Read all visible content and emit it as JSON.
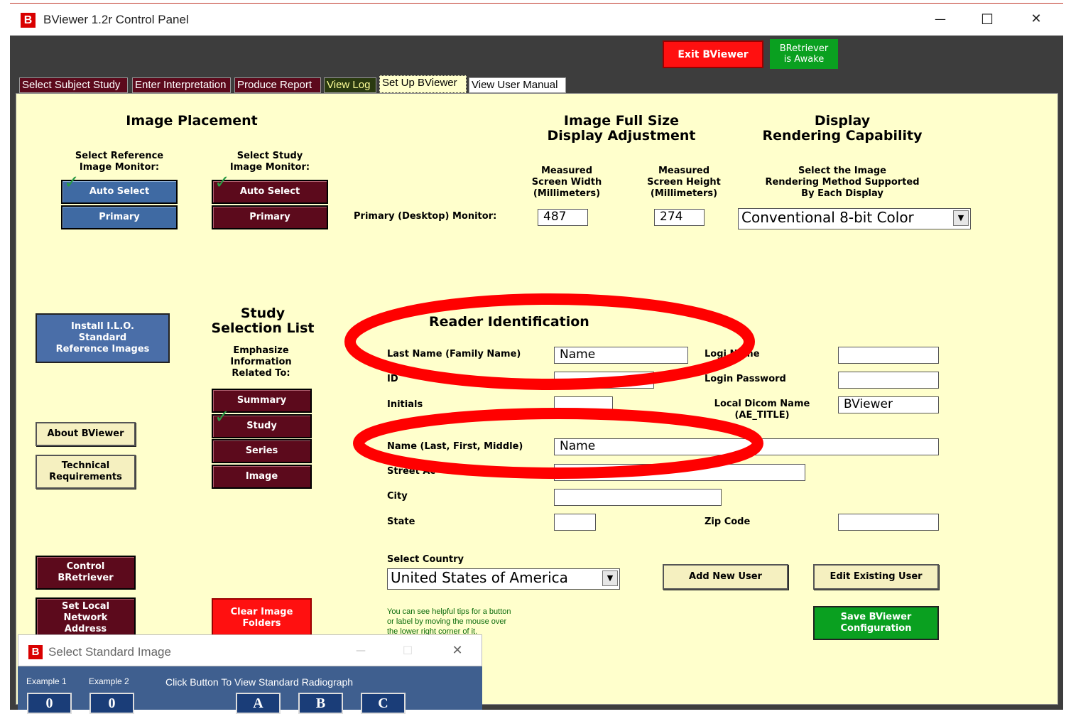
{
  "window": {
    "title": "BViewer 1.2r Control Panel",
    "logo_letter": "B",
    "minimize": "—",
    "maximize": "☐",
    "close": "✕"
  },
  "top_buttons": {
    "exit": "Exit BViewer",
    "bretriever_line1": "BRetriever",
    "bretriever_line2": "is Awake"
  },
  "tabs": [
    "Select Subject Study",
    "Enter Interpretation",
    "Produce Report",
    "View Log",
    "Set Up BViewer",
    "View User Manual"
  ],
  "image_placement": {
    "title": "Image Placement",
    "ref_label_1": "Select Reference",
    "ref_label_2": "Image Monitor:",
    "study_label_1": "Select Study",
    "study_label_2": "Image Monitor:",
    "auto_select": "Auto Select",
    "primary": "Primary"
  },
  "full_size": {
    "title_1": "Image Full Size",
    "title_2": "Display Adjustment",
    "width_label_1": "Measured",
    "width_label_2": "Screen Width",
    "width_label_3": "(Millimeters)",
    "height_label_1": "Measured",
    "height_label_2": "Screen Height",
    "height_label_3": "(Millimeters)",
    "monitor_label": "Primary (Desktop) Monitor:",
    "width_value": "487",
    "height_value": "274"
  },
  "rendering": {
    "title_1": "Display",
    "title_2": "Rendering Capability",
    "label_1": "Select the Image",
    "label_2": "Rendering Method Supported",
    "label_3": "By Each Display",
    "selected": "Conventional 8-bit Color"
  },
  "left_buttons": {
    "install_1": "Install I.L.O.",
    "install_2": "Standard",
    "install_3": "Reference Images",
    "about": "About BViewer",
    "tech_1": "Technical",
    "tech_2": "Requirements",
    "control_1": "Control",
    "control_2": "BRetriever",
    "setlocal_1": "Set Local",
    "setlocal_2": "Network",
    "setlocal_3": "Address"
  },
  "study_list": {
    "title_1": "Study",
    "title_2": "Selection List",
    "label_1": "Emphasize",
    "label_2": "Information",
    "label_3": "Related To:",
    "summary": "Summary",
    "study": "Study",
    "series": "Series",
    "image": "Image",
    "clear_1": "Clear Image",
    "clear_2": "Folders"
  },
  "reader": {
    "title": "Reader Identification",
    "last_name_label": "Last Name (Family Name)",
    "last_name_value": "Name",
    "id_label": "ID",
    "initials_label": "Initials",
    "full_name_label": "Name (Last, First, Middle)",
    "full_name_value": "Name",
    "street_label": "Street Ac",
    "city_label": "City",
    "state_label": "State",
    "zip_label": "Zip Code",
    "login_name_label": "Logi     Name",
    "login_password_label": "Login Password",
    "dicom_label_1": "Local Dicom Name",
    "dicom_label_2": "(AE_TITLE)",
    "dicom_value": "BViewer",
    "country_label": "Select Country",
    "country_value": "United States of America",
    "add_user": "Add New User",
    "edit_user": "Edit Existing User",
    "save_1": "Save BViewer",
    "save_2": "Configuration",
    "tip_1": "You can see helpful tips for a button",
    "tip_2": "or label by moving the mouse over",
    "tip_3": "the lower right corner of it."
  },
  "sub_window": {
    "title": "Select Standard Image",
    "logo_letter": "B",
    "example1": "Example 1",
    "example2": "Example 2",
    "instruction": "Click Button To View Standard Radiograph",
    "ex1_value": "0",
    "ex2_value": "0",
    "btn_a": "A",
    "btn_b": "B",
    "btn_c": "C"
  },
  "colors": {
    "panel_bg": "#ffffcc",
    "maroon": "#5c0a1c",
    "blue": "#3f6aa3",
    "red": "#ff1010",
    "green": "#0aa020",
    "annotation": "#ff0000"
  }
}
